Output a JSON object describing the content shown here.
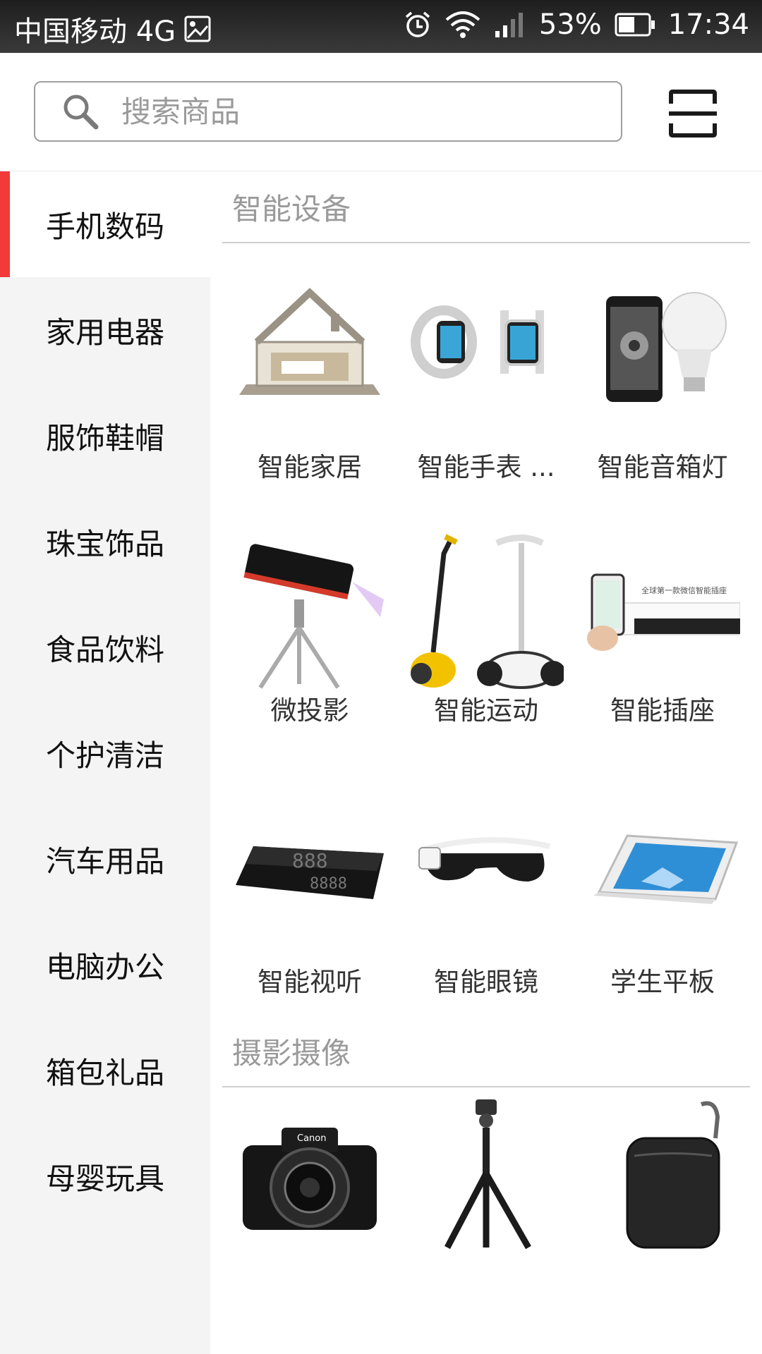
{
  "status_bar": {
    "carrier": "中国移动 4G",
    "battery_percent": "53%",
    "time": "17:34",
    "icons": [
      "image-icon",
      "alarm-icon",
      "wifi-icon",
      "signal-icon",
      "battery-icon"
    ]
  },
  "search": {
    "placeholder": "搜索商品",
    "scan_icon": "scan-icon"
  },
  "sidebar": {
    "accent_color": "#f23a3a",
    "items": [
      {
        "label": "手机数码",
        "active": true
      },
      {
        "label": "家用电器"
      },
      {
        "label": "服饰鞋帽"
      },
      {
        "label": "珠宝饰品"
      },
      {
        "label": "食品饮料"
      },
      {
        "label": "个护清洁"
      },
      {
        "label": "汽车用品"
      },
      {
        "label": "电脑办公"
      },
      {
        "label": "箱包礼品"
      },
      {
        "label": "母婴玩具"
      }
    ]
  },
  "sections": [
    {
      "title": "智能设备",
      "items": [
        {
          "label": "智能家居",
          "icon": "smart-home-image"
        },
        {
          "label": "智能手表 ...",
          "icon": "smart-watch-image"
        },
        {
          "label": "智能音箱灯",
          "icon": "speaker-bulb-image"
        },
        {
          "label": "微投影",
          "icon": "mini-projector-image"
        },
        {
          "label": "智能运动",
          "icon": "balance-scooter-image"
        },
        {
          "label": "智能插座",
          "icon": "smart-socket-image"
        },
        {
          "label": "智能视听",
          "icon": "hud-display-image"
        },
        {
          "label": "智能眼镜",
          "icon": "smart-glasses-image"
        },
        {
          "label": "学生平板",
          "icon": "student-tablet-image"
        }
      ]
    },
    {
      "title": "摄影摄像",
      "items": [
        {
          "label": "",
          "icon": "dslr-camera-image"
        },
        {
          "label": "",
          "icon": "tripod-image"
        },
        {
          "label": "",
          "icon": "camera-case-image"
        }
      ]
    }
  ],
  "photo_texts": {
    "camera_brand": "Canon",
    "socket_banner": "全球第一款微信智能插座"
  }
}
